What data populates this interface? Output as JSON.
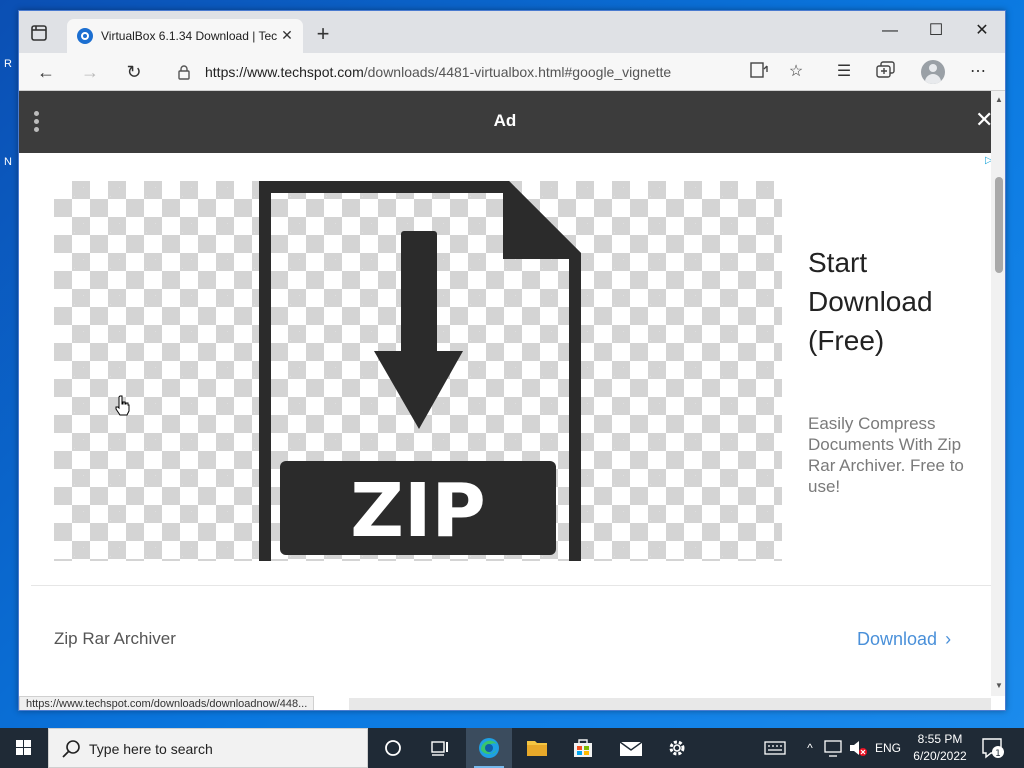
{
  "browser": {
    "tab_title": "VirtualBox 6.1.34 Download | Tec",
    "url_host": "https://www.techspot.com",
    "url_path": "/downloads/4481-virtualbox.html#google_vignette",
    "status_url": "https://www.techspot.com/downloads/downloadnow/448..."
  },
  "ad": {
    "bar_label": "Ad",
    "headline_lines": [
      "Start",
      "Download",
      "(Free)"
    ],
    "description": "Easily Compress Documents With Zip Rar Archiver. Free to use!",
    "image_text": "ZIP",
    "brand": "Zip Rar Archiver",
    "cta": "Download"
  },
  "taskbar": {
    "search_placeholder": "Type here to search",
    "language": "ENG",
    "time": "8:55 PM",
    "date": "6/20/2022",
    "notification_count": "1"
  },
  "desktop": {
    "edge_glyphs": [
      "R",
      "N"
    ]
  },
  "colors": {
    "ad_bar": "#3c3c3c",
    "cta_blue": "#4a90d9",
    "taskbar": "#1f2a36"
  }
}
